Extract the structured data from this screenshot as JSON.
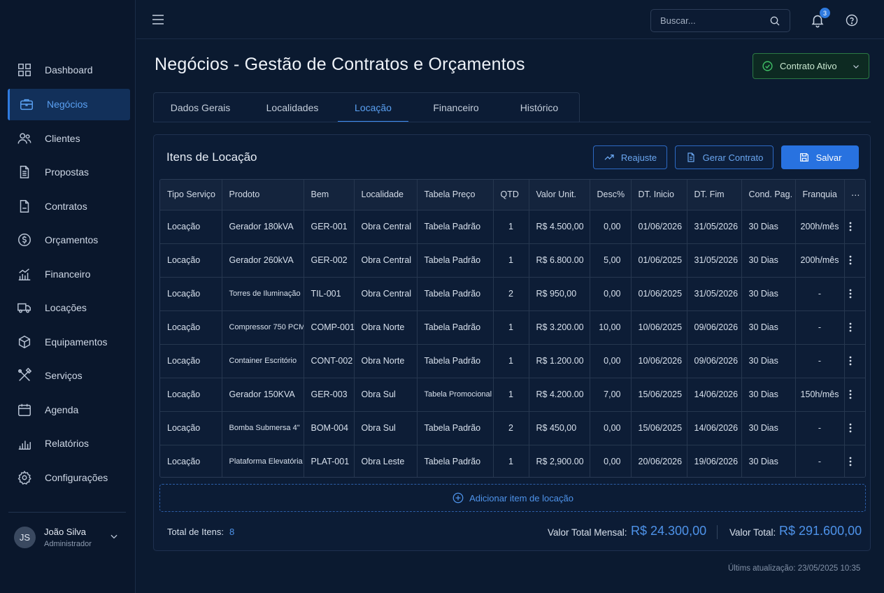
{
  "sidebar": {
    "items": [
      {
        "label": "Dashboard",
        "icon": "dashboard-icon"
      },
      {
        "label": "Negócios",
        "icon": "briefcase-icon",
        "active": true
      },
      {
        "label": "Clientes",
        "icon": "users-icon"
      },
      {
        "label": "Propostas",
        "icon": "document-icon"
      },
      {
        "label": "Contratos",
        "icon": "contract-icon"
      },
      {
        "label": "Orçamentos",
        "icon": "dollar-circle-icon"
      },
      {
        "label": "Financeiro",
        "icon": "finance-chart-icon"
      },
      {
        "label": "Locações",
        "icon": "truck-icon"
      },
      {
        "label": "Equipamentos",
        "icon": "box-icon"
      },
      {
        "label": "Serviços",
        "icon": "tools-icon"
      },
      {
        "label": "Agenda",
        "icon": "calendar-icon"
      },
      {
        "label": "Relatórios",
        "icon": "bar-chart-icon"
      },
      {
        "label": "Configurações",
        "icon": "gear-icon"
      }
    ],
    "user": {
      "initials": "JS",
      "name": "João Silva",
      "role": "Administrador"
    }
  },
  "topbar": {
    "search_placeholder": "Buscar...",
    "notification_count": "3"
  },
  "header": {
    "title": "Negócios - Gestão de Contratos e Orçamentos",
    "status_label": "Contrato Ativo"
  },
  "tabs": [
    {
      "label": "Dados Gerais"
    },
    {
      "label": "Localidades"
    },
    {
      "label": "Locação",
      "active": true
    },
    {
      "label": "Financeiro"
    },
    {
      "label": "Histórico"
    }
  ],
  "panel": {
    "title": "Itens de Locação",
    "reajuste_label": "Reajuste",
    "gerar_label": "Gerar Contrato",
    "salvar_label": "Salvar",
    "add_label": "Adicionar item de locação"
  },
  "table": {
    "columns": [
      "Tipo Serviço",
      "Prodoto",
      "Bem",
      "Localidade",
      "Tabela Preço",
      "QTD",
      "Valor Unit.",
      "Desc%",
      "DT. Inicio",
      "DT. Fim",
      "Cond. Pag.",
      "Franquia",
      "⋯"
    ],
    "rows": [
      [
        "Locação",
        "Gerador 180kVA",
        "GER-001",
        "Obra Central",
        "Tabela Padrão",
        "1",
        "R$  4.500,00",
        "0,00",
        "01/06/2026",
        "31/05/2026",
        "30 Dias",
        "200h/mês"
      ],
      [
        "Locação",
        "Gerador 260kVA",
        "GER-002",
        "Obra Central",
        "Tabela Padrão",
        "1",
        "R$  6.800.00",
        "5,00",
        "01/06/2025",
        "31/05/2026",
        "30 Dias",
        "200h/mês"
      ],
      [
        "Locação",
        "Torres de Iluminação",
        "TIL-001",
        "Obra Central",
        "Tabela Padrão",
        "2",
        "R$  950,00",
        "0,00",
        "01/06/2025",
        "31/05/2026",
        "30 Dias",
        "-"
      ],
      [
        "Locação",
        "Compressor 750 PCM",
        "COMP-001",
        "Obra Norte",
        "Tabela Padrão",
        "1",
        "R$  3.200.00",
        "10,00",
        "10/06/2025",
        "09/06/2026",
        "30 Dias",
        "-"
      ],
      [
        "Locação",
        "Container Escritório",
        "CONT-002",
        "Obra Norte",
        "Tabela Padrão",
        "1",
        "R$  1.200.00",
        "0,00",
        "10/06/2026",
        "09/06/2026",
        "30 Dias",
        "-"
      ],
      [
        "Locação",
        "Gerador 150KVA",
        "GER-003",
        "Obra Sul",
        "Tabela Promocional",
        "1",
        "R$  4.200.00",
        "7,00",
        "15/06/2025",
        "14/06/2026",
        "30 Dias",
        "150h/mês"
      ],
      [
        "Locação",
        "Bomba Submersa 4\"",
        "BOM-004",
        "Obra Sul",
        "Tabela Padrão",
        "2",
        "R$  450,00",
        "0,00",
        "15/06/2025",
        "14/06/2026",
        "30 Dias",
        "-"
      ],
      [
        "Locação",
        "Plataforma Elevatória",
        "PLAT-001",
        "Obra Leste",
        "Tabela Padrão",
        "1",
        "R$  2,900.00",
        "0,00",
        "20/06/2026",
        "19/06/2026",
        "30 Dias",
        "-"
      ]
    ]
  },
  "footer": {
    "total_items_label": "Total de Itens:",
    "total_items": "8",
    "monthly_label": "Valor Total Mensal:",
    "monthly_value": "R$ 24.300,00",
    "total_label": "Valor Total:",
    "total_value": "R$ 291.600,00",
    "updated": "Últims atualização: 23/05/2025 10:35"
  },
  "colors": {
    "background": "#0b1a30",
    "accent": "#2872e0",
    "success": "#3fbf66"
  }
}
